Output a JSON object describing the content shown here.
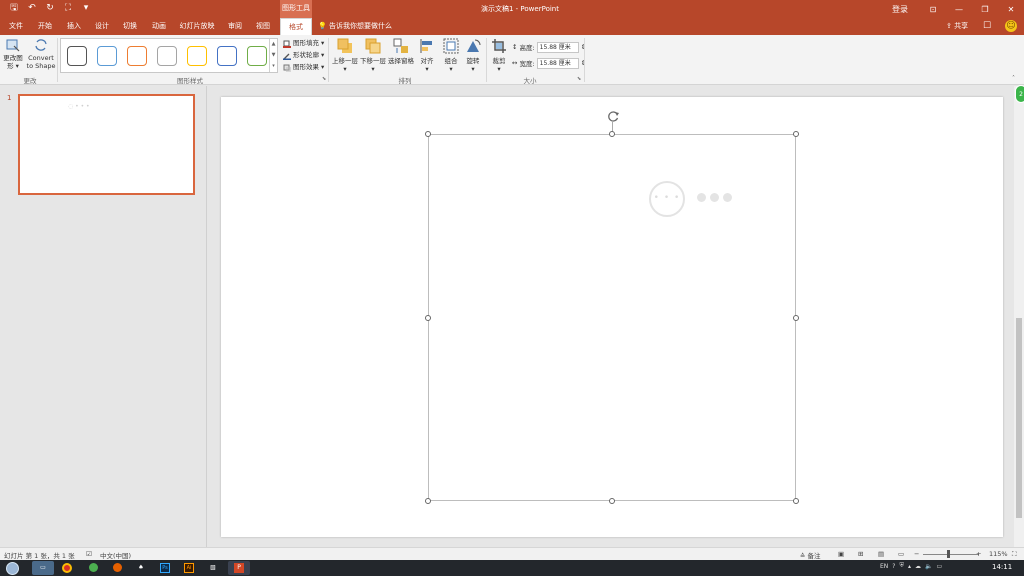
{
  "titlebar": {
    "context_tab": "图形工具",
    "title": "演示文稿1  -  PowerPoint",
    "login": "登录",
    "accent": "#b7472a"
  },
  "tabs": {
    "items": [
      "文件",
      "开始",
      "插入",
      "设计",
      "切换",
      "动画",
      "幻灯片放映",
      "审阅",
      "视图",
      "格式"
    ],
    "active": "格式",
    "tell_me": "告诉我你想要做什么",
    "share": "共享"
  },
  "ribbon": {
    "change_group": {
      "edit_shape": "更改图形",
      "convert_line1": "Convert",
      "convert_line2": "to Shape",
      "label": "更改"
    },
    "styles_group": {
      "label": "图形样式",
      "swatch_colors": [
        "#555555",
        "#5b9bd5",
        "#ed7d31",
        "#a5a5a5",
        "#ffc000",
        "#4472c4",
        "#70ad47"
      ],
      "fill": "图形填充",
      "outline": "形状轮廓",
      "effects": "图形效果"
    },
    "arrange_group": {
      "label": "排列",
      "bring_forward": "上移一层",
      "send_backward": "下移一层",
      "selection_pane": "选择窗格",
      "align": "对齐",
      "group": "组合",
      "rotate": "旋转"
    },
    "size_group": {
      "label": "大小",
      "crop": "裁剪",
      "height_label": "高度:",
      "height_value": "15.88 厘米",
      "width_label": "宽度:",
      "width_value": "15.88 厘米"
    }
  },
  "thumbnails": {
    "slide_number": "1",
    "placeholder": "◌ • • •"
  },
  "slide": {
    "loading_text": "• • •"
  },
  "statusbar": {
    "slide_info": "幻灯片 第 1 张，共 1 张",
    "language": "中文(中国)",
    "notes": "备注",
    "zoom": "115%"
  },
  "taskbar": {
    "time": "14:11",
    "ime": "EN"
  },
  "green_badge": "2"
}
